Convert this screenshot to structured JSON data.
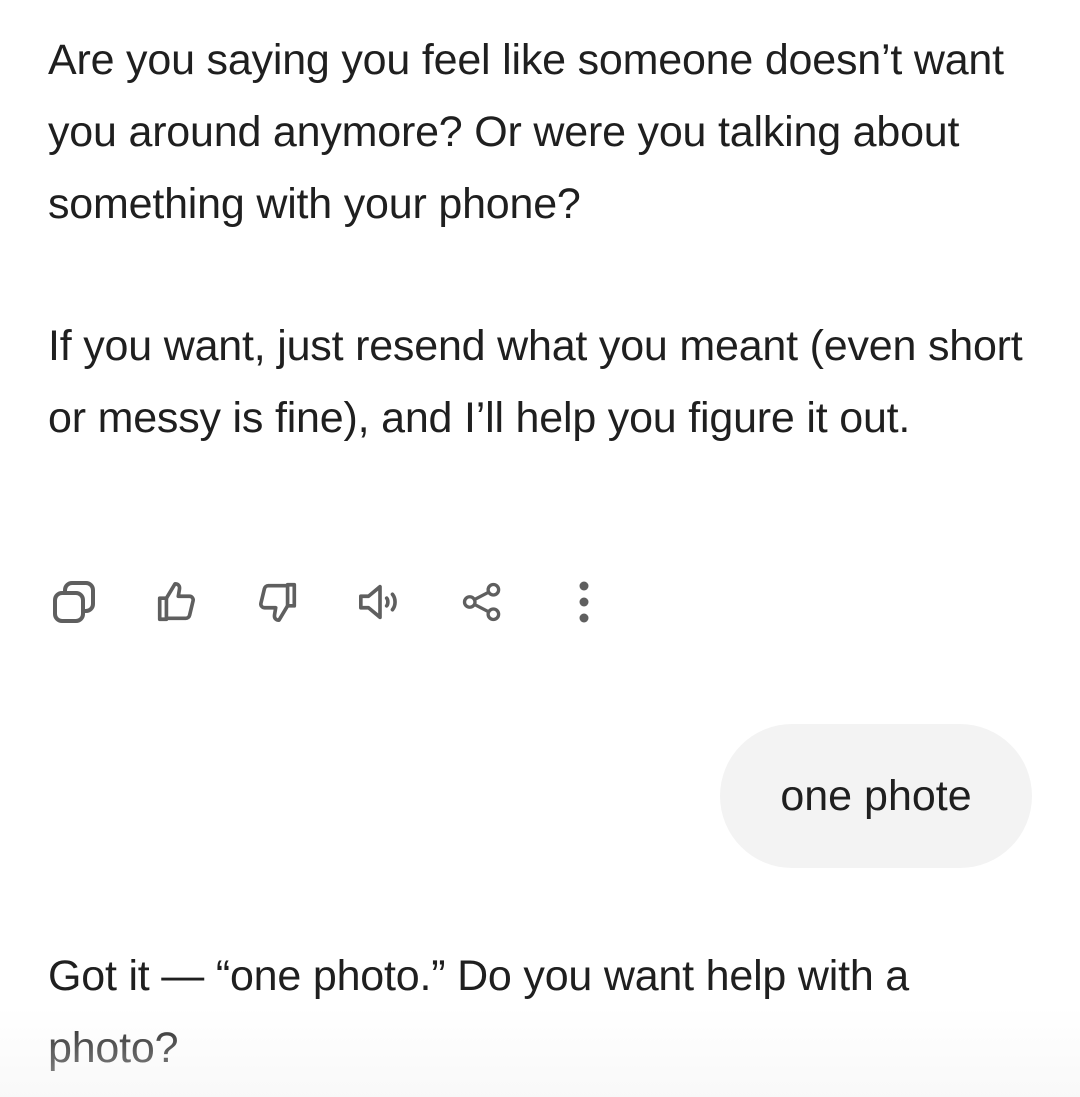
{
  "conversation": {
    "assistant_message_1": {
      "paragraph_1": "Are you saying you feel like someone doesn’t want you around anymore? Or were you talking about something with your phone?",
      "paragraph_2": "If you want, just resend what you meant (even short or messy is fine), and I’ll help you figure it out."
    },
    "action_bar": {
      "icons": [
        "copy-icon",
        "thumbs-up-icon",
        "thumbs-down-icon",
        "speaker-icon",
        "share-icon",
        "more-vertical-icon"
      ]
    },
    "user_message": {
      "text": "one phote"
    },
    "assistant_message_2": {
      "text": "Got it — “one photo.” Do you want help with a photo?"
    }
  },
  "colors": {
    "text": "#1f1f1f",
    "icon": "#5f5f5f",
    "user_bubble_bg": "#f3f3f3",
    "background": "#ffffff"
  }
}
